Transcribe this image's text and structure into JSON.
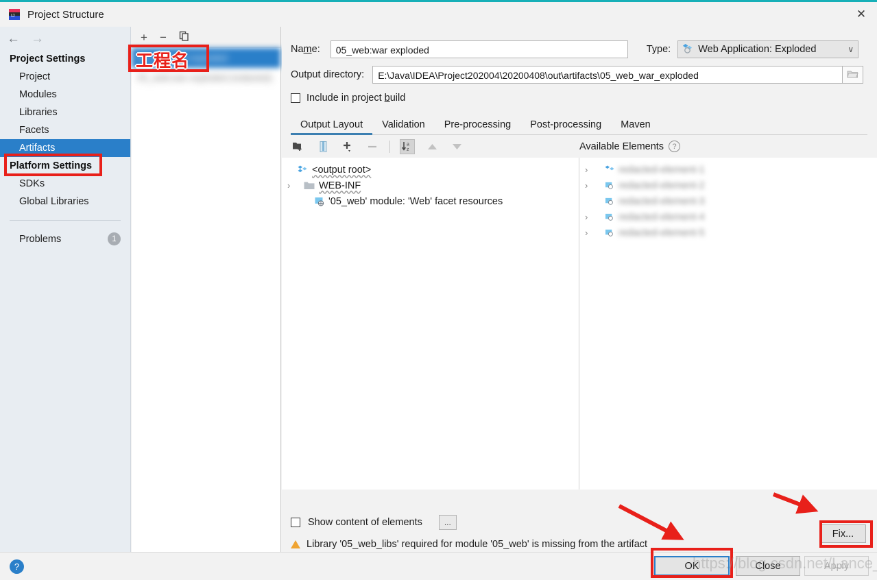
{
  "window": {
    "title": "Project Structure",
    "close_label": "✕",
    "app_icon": "intellij-idea-icon"
  },
  "nav": {
    "back": "←",
    "forward": "→"
  },
  "sidebar": {
    "sections": [
      {
        "heading": "Project Settings",
        "items": [
          {
            "label": "Project",
            "selected": false
          },
          {
            "label": "Modules",
            "selected": false
          },
          {
            "label": "Libraries",
            "selected": false
          },
          {
            "label": "Facets",
            "selected": false
          },
          {
            "label": "Artifacts",
            "selected": true
          }
        ]
      },
      {
        "heading": "Platform Settings",
        "items": [
          {
            "label": "SDKs",
            "selected": false
          },
          {
            "label": "Global Libraries",
            "selected": false
          }
        ]
      }
    ],
    "problems": {
      "label": "Problems",
      "count": "1"
    }
  },
  "artifact_list": {
    "toolbar": [
      {
        "name": "add-artifact-button",
        "glyph": "+"
      },
      {
        "name": "remove-artifact-button",
        "glyph": "−"
      },
      {
        "name": "copy-artifact-button",
        "glyph": "❐"
      }
    ],
    "rows": [
      {
        "label": "05_web:war exploded",
        "selected": true,
        "blurred": true
      },
      {
        "label": "05_web:war exploded (redacted)",
        "selected": false,
        "blurred": true
      }
    ]
  },
  "detail": {
    "name_label": "Na",
    "name_label_mnemonic": "m",
    "name_label_rest": "e:",
    "name_value": "05_web:war exploded",
    "type_label": "Type:",
    "type_value": "Web Application: Exploded",
    "type_icon": "artifact-icon",
    "type_chevron": "∨",
    "output_dir_label": "Output directory:",
    "output_dir_value": "E:\\Java\\IDEA\\Project202004\\20200408\\out\\artifacts\\05_web_war_exploded",
    "browse_icon": "folder-browse-icon",
    "include_label_pre": "Include in project ",
    "include_label_mnemonic": "b",
    "include_label_post": "uild",
    "include_checked": false,
    "tabs": [
      {
        "label": "Output Layout",
        "active": true
      },
      {
        "label": "Validation",
        "active": false
      },
      {
        "label": "Pre-processing",
        "active": false
      },
      {
        "label": "Post-processing",
        "active": false
      },
      {
        "label": "Maven",
        "active": false
      }
    ],
    "layout_toolbar": [
      {
        "name": "create-directory-icon",
        "glyph": "ὛF",
        "state": "enabled"
      },
      {
        "name": "create-archive-icon",
        "glyph": "‖",
        "state": "enabled"
      },
      {
        "name": "add-element-icon",
        "glyph": "+",
        "state": "enabled"
      },
      {
        "name": "remove-element-icon",
        "glyph": "−",
        "state": "disabled"
      },
      {
        "name": "sort-by-name-icon",
        "glyph": "↓az",
        "state": "pressed"
      },
      {
        "name": "move-up-icon",
        "glyph": "▲",
        "state": "disabled"
      },
      {
        "name": "move-down-icon",
        "glyph": "▼",
        "state": "disabled"
      }
    ],
    "available_elements_label": "Available Elements",
    "available_elements_help": "?",
    "output_tree": [
      {
        "label": "<output root>",
        "indent": 0,
        "twist": "",
        "icon": "output-root-icon",
        "underline": "wavy"
      },
      {
        "label": "WEB-INF",
        "indent": 0,
        "twist": "›",
        "icon": "folder-icon",
        "underline": "wavy"
      },
      {
        "label": "'05_web' module: 'Web' facet resources",
        "indent": 1,
        "twist": "",
        "icon": "facet-resources-icon",
        "underline": "none"
      }
    ],
    "available_tree": [
      {
        "label": "redacted-element-1",
        "twist": "›",
        "blurred": true
      },
      {
        "label": "redacted-element-2",
        "twist": "›",
        "blurred": true
      },
      {
        "label": "redacted-element-3",
        "twist": "",
        "blurred": true
      },
      {
        "label": "redacted-element-4",
        "twist": "›",
        "blurred": true
      },
      {
        "label": "redacted-element-5",
        "twist": "›",
        "blurred": true
      }
    ],
    "show_content_label": "Show content of elements",
    "show_content_checked": false,
    "dots_button": "...",
    "warning_text": "Library '05_web_libs' required for module '05_web' is missing from the artifact",
    "fix_button": "Fix..."
  },
  "footer": {
    "help_icon": "?",
    "ok_label": "OK",
    "close_label": "Close",
    "apply_label": "Apply",
    "apply_disabled": true
  },
  "annotations": {
    "project_name_note": "工程名",
    "accent_color": "#e8201a",
    "watermark": "https://blog.csdn.net/Lance_welcome"
  }
}
